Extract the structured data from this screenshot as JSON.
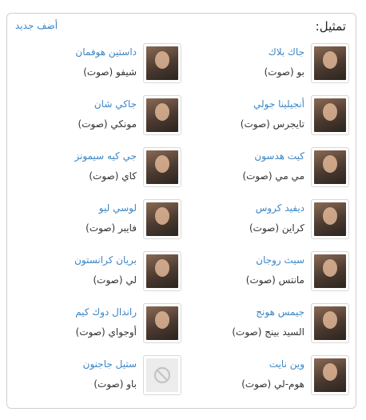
{
  "header": {
    "title": "تمثيل:",
    "add_label": "أضف جديد"
  },
  "cast": [
    {
      "name": "جاك بلاك",
      "role": "بو (صوت)"
    },
    {
      "name": "داستين هوفمان",
      "role": "شيفو (صوت)"
    },
    {
      "name": "أنجيلينا جولي",
      "role": "تايجرس (صوت)"
    },
    {
      "name": "جاكي شان",
      "role": "مونكي (صوت)"
    },
    {
      "name": "كيت هدسون",
      "role": "مي مي (صوت)"
    },
    {
      "name": "جي كيه سيمونز",
      "role": "كاي (صوت)"
    },
    {
      "name": "ديفيد كروس",
      "role": "كراين (صوت)"
    },
    {
      "name": "لوسي ليو",
      "role": "فايبر (صوت)"
    },
    {
      "name": "سيث روجان",
      "role": "مانتس (صوت)"
    },
    {
      "name": "بريان كرانستون",
      "role": "لي (صوت)"
    },
    {
      "name": "جيمس هونج",
      "role": "السيد بينج (صوت)"
    },
    {
      "name": "راندال دوك كيم",
      "role": "أوجواي (صوت)"
    },
    {
      "name": "وين نايت",
      "role": "هوم-لي (صوت)"
    },
    {
      "name": "ستيل جاجنون",
      "role": "باو (صوت)"
    }
  ]
}
